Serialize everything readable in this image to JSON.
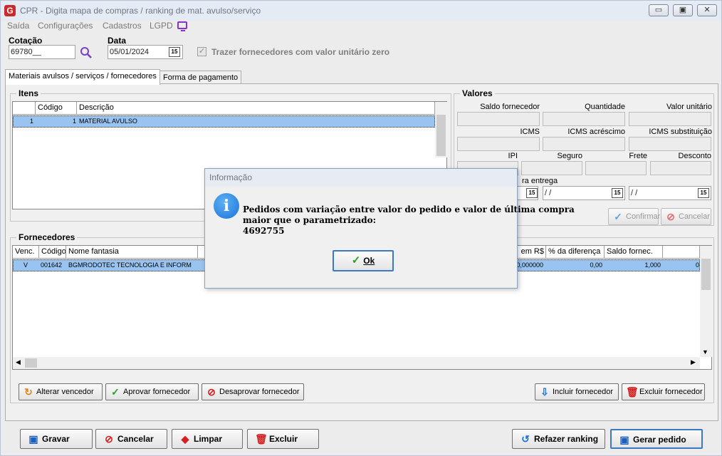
{
  "window": {
    "title": "CPR - Digita mapa de compras / ranking de mat. avulso/serviço",
    "icon_letter": "G",
    "controls": {
      "minimize": "▭",
      "restore": "▣",
      "close": "✕"
    }
  },
  "menu": [
    {
      "label": "Saída"
    },
    {
      "label": "Configurações"
    },
    {
      "label": "Cadastros"
    },
    {
      "label": "LGPD"
    }
  ],
  "header": {
    "cotacao_label": "Cotação",
    "cotacao_value": "69780__",
    "data_label": "Data",
    "data_value": "05/01/2024",
    "calendar_glyph": "15",
    "checkbox_label": "Trazer fornecedores com valor unitário zero",
    "checkbox_checked": true,
    "check_glyph": "✓"
  },
  "tabs": [
    {
      "label": "Materiais avulsos / serviços / fornecedores",
      "active": true
    },
    {
      "label": "Forma de pagamento",
      "active": false
    }
  ],
  "itens": {
    "title": "Itens",
    "columns": [
      "",
      "Código",
      "Descrição"
    ],
    "rows": [
      {
        "index": "1",
        "codigo": "1",
        "descricao": "MATERIAL AVULSO"
      }
    ]
  },
  "valores": {
    "title": "Valores",
    "row1": [
      "Saldo fornecedor",
      "Quantidade",
      "Valor unitário"
    ],
    "row2": [
      "ICMS",
      "ICMS acréscimo",
      "ICMS substituição"
    ],
    "row3": [
      "IPI",
      "Seguro",
      "Frete",
      "Desconto"
    ],
    "entrega_label": "ra entrega",
    "date_placeholder": " / /",
    "confirmar": "Confirmar",
    "cancelar": "Cancelar"
  },
  "fornecedores": {
    "title": "Fornecedores",
    "columns": [
      "Venc.",
      "Código",
      "Nome fantasia",
      "em R$",
      "% da diferença",
      "Saldo fornec."
    ],
    "rows": [
      {
        "venc": "V",
        "codigo": "001642",
        "nome": "BGMRODOTEC TECNOLOGIA E INFORM",
        "valor": "0,000000",
        "diferenca": "0,00",
        "saldo": "1,000",
        "extra": "0"
      }
    ],
    "buttons": {
      "alterar": "Alterar vencedor",
      "aprovar": "Aprovar fornecedor",
      "desaprovar": "Desaprovar fornecedor",
      "incluir": "Incluir fornecedor",
      "excluir": "Excluir fornecedor"
    }
  },
  "footer": {
    "gravar": "Gravar",
    "cancelar": "Cancelar",
    "limpar": "Limpar",
    "excluir": "Excluir",
    "refazer": "Refazer ranking",
    "gerar": "Gerar pedido"
  },
  "dialog": {
    "title": "Informação",
    "line1": "Pedidos com variação entre valor do pedido e valor de última compra",
    "line2": "maior que o parametrizado:",
    "line3": "4692755",
    "ok": "Ok"
  },
  "colors": {
    "selection": "#99c3f0",
    "focus": "#3b79c6",
    "info": "#1a73d8"
  }
}
